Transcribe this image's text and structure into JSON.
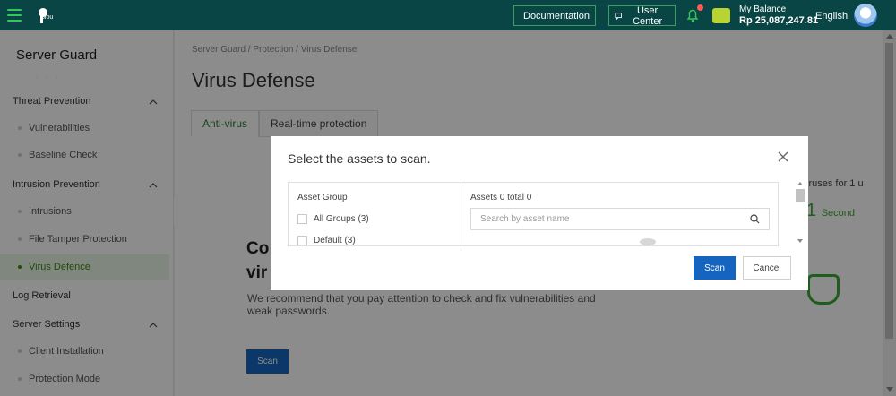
{
  "topbar": {
    "logo_text": "plou",
    "documentation_label": "Documentation",
    "user_center_label": "User Center",
    "balance_label": "My Balance",
    "balance_amount": "Rp 25,087,247.81",
    "language": "English"
  },
  "sidebar": {
    "title": "Server Guard",
    "threat_prevention": "Threat Prevention",
    "vulnerabilities": "Vulnerabilities",
    "baseline_check": "Baseline Check",
    "intrusion_prevention": "Intrusion Prevention",
    "intrusions": "Intrusions",
    "file_tamper_protection": "File Tamper Protection",
    "virus_defence": "Virus Defence",
    "log_retrieval": "Log Retrieval",
    "server_settings": "Server Settings",
    "client_installation": "Client Installation",
    "protection_mode": "Protection Mode"
  },
  "main": {
    "breadcrumb": "Server Guard  /  Protection  /  Virus Defense",
    "title": "Virus Defense",
    "tabs": [
      {
        "label": "Anti-virus"
      },
      {
        "label": "Real-time protection"
      }
    ],
    "scan_title_1": "Co",
    "scan_title_2": "vir",
    "scan_desc": "We recommend that you pay attention to check and fix vulnerabilities and weak passwords.",
    "scan_button": "Scan",
    "side_virus_text": "iruses for 1 u",
    "side_second_value": "1",
    "side_second_unit": "Second"
  },
  "modal": {
    "title": "Select the assets to scan.",
    "asset_group_header": "Asset Group",
    "groups": [
      {
        "label": "All Groups (3)"
      },
      {
        "label": "Default (3)"
      }
    ],
    "assets_header": "Assets 0 total 0",
    "search_placeholder": "Search by asset name",
    "scan_label": "Scan",
    "cancel_label": "Cancel"
  },
  "colors": {
    "topbar": "#0a4545",
    "primary_button": "#1565c0",
    "active_green": "#3a8a12"
  }
}
